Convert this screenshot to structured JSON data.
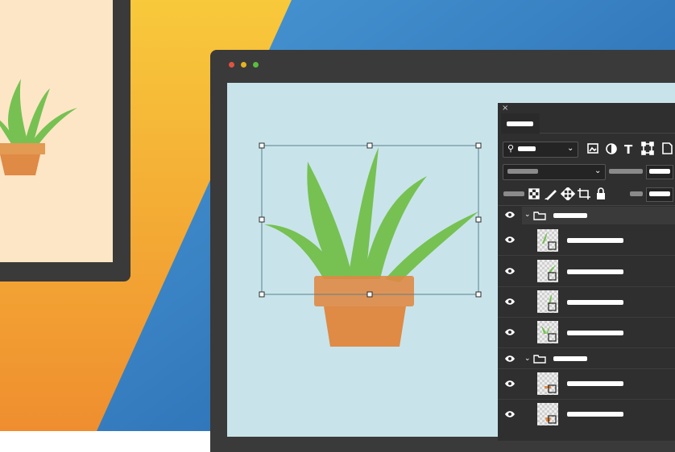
{
  "colors": {
    "background_yellow": "#f6bf3a",
    "background_orange": "#ef8e2f",
    "background_blue": "#2f7fc4",
    "window_chrome": "#3a3a3a",
    "canvas": "#c8e4ea",
    "panel": "#2f2f2f",
    "leaf_green": "#76c152",
    "pot_orange": "#df8a45",
    "traffic_red": "#e1533f",
    "traffic_yellow": "#e7b21f",
    "traffic_green": "#5dbb3f"
  },
  "window": {
    "buttons": [
      "close-dot",
      "minimize-dot",
      "maximize-dot"
    ]
  },
  "panel": {
    "close_glyph": "×",
    "toolbar_icons": [
      "search-icon",
      "image-icon",
      "contrast-icon",
      "text-icon",
      "transform-icon",
      "document-icon"
    ],
    "toolbar2_icons": [
      "transparency-icon",
      "brush-icon",
      "move-icon",
      "crop-icon",
      "lock-icon"
    ],
    "type_glyph": "T",
    "eye_glyph": "👁",
    "lock_glyph": "🔒",
    "layers": [
      {
        "kind": "group",
        "expanded": true
      },
      {
        "kind": "layer",
        "thumb": "leaf"
      },
      {
        "kind": "layer",
        "thumb": "leaf"
      },
      {
        "kind": "layer",
        "thumb": "leaf"
      },
      {
        "kind": "layer",
        "thumb": "leaf"
      },
      {
        "kind": "group",
        "expanded": true
      },
      {
        "kind": "layer",
        "thumb": "pot"
      },
      {
        "kind": "layer",
        "thumb": "pot"
      }
    ]
  }
}
